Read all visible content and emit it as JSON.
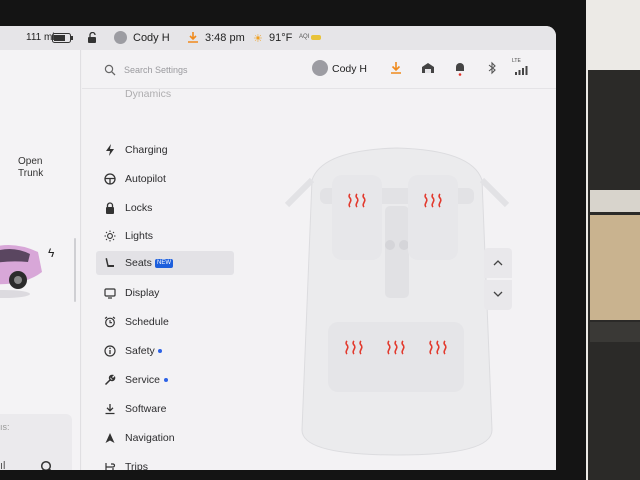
{
  "status_bar": {
    "range": "111 mi",
    "profile": "Cody H",
    "time": "3:48 pm",
    "temperature": "91°F",
    "aqi_label": "AQI"
  },
  "left_panel": {
    "open_trunk_line1": "Open",
    "open_trunk_line2": "Trunk",
    "card_label": "ıs:"
  },
  "header": {
    "search_placeholder": "Search Settings",
    "user_name": "Cody H",
    "lte_label": "LTE"
  },
  "menu": {
    "items": [
      {
        "label": "Dynamics",
        "icon": "dynamics-icon"
      },
      {
        "label": "Charging",
        "icon": "bolt-icon"
      },
      {
        "label": "Autopilot",
        "icon": "steering-wheel-icon"
      },
      {
        "label": "Locks",
        "icon": "lock-icon"
      },
      {
        "label": "Lights",
        "icon": "sun-icon"
      },
      {
        "label": "Seats",
        "icon": "seat-icon",
        "badge": "NEW",
        "active": true
      },
      {
        "label": "Display",
        "icon": "display-icon"
      },
      {
        "label": "Schedule",
        "icon": "alarm-clock-icon"
      },
      {
        "label": "Safety",
        "icon": "info-circle-icon",
        "dot": true
      },
      {
        "label": "Service",
        "icon": "wrench-icon",
        "dot": true
      },
      {
        "label": "Software",
        "icon": "download-icon"
      },
      {
        "label": "Navigation",
        "icon": "navigation-arrow-icon"
      },
      {
        "label": "Trips",
        "icon": "trips-icon"
      }
    ]
  },
  "seat_heaters": {
    "front_left": "heating",
    "front_right": "heating",
    "rear_left": "heating",
    "rear_center": "heating",
    "rear_right": "heating"
  },
  "colors": {
    "accent_blue": "#1d5fdc",
    "heater_red": "#e23a2e",
    "download_orange": "#f08a1c",
    "alert_red": "#e0332a"
  }
}
